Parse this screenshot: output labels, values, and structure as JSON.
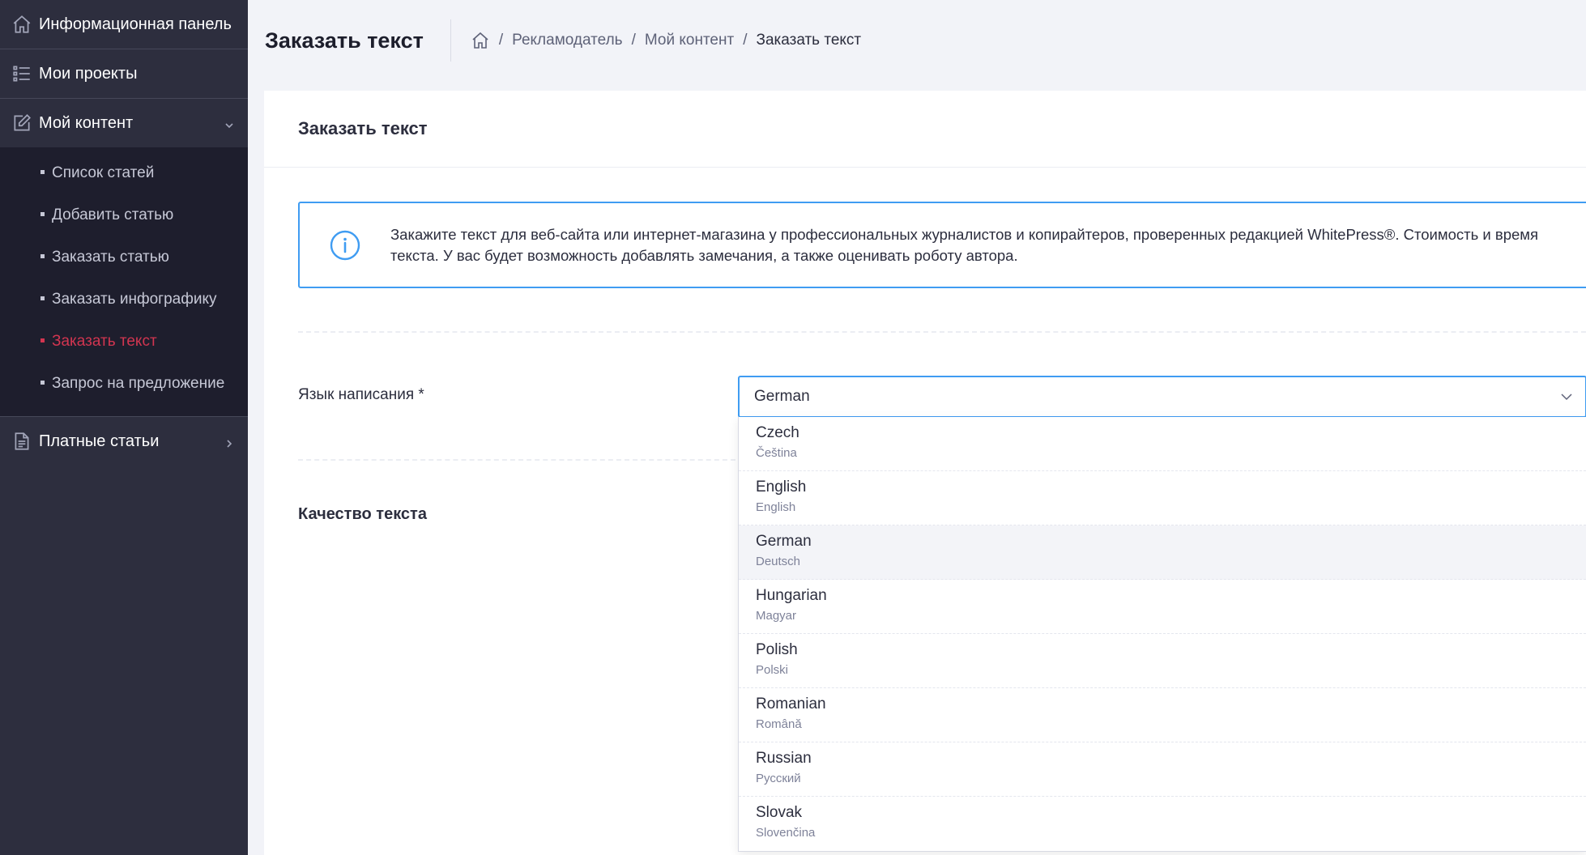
{
  "sidebar": {
    "items": [
      {
        "label": "Информационная панель",
        "icon": "home-icon"
      },
      {
        "label": "Мои проекты",
        "icon": "list-icon"
      },
      {
        "label": "Мой контент",
        "icon": "edit-icon",
        "expanded": true
      },
      {
        "label": "Платные статьи",
        "icon": "document-icon",
        "expanded": false
      }
    ],
    "sub_items": [
      {
        "label": "Список статей",
        "active": false
      },
      {
        "label": "Добавить статью",
        "active": false
      },
      {
        "label": "Заказать статью",
        "active": false
      },
      {
        "label": "Заказать инфографику",
        "active": false
      },
      {
        "label": "Заказать текст",
        "active": true
      },
      {
        "label": "Запрос на предложение",
        "active": false
      }
    ]
  },
  "header": {
    "title": "Заказать текст",
    "breadcrumb": [
      "Рекламодатель",
      "Мой контент",
      "Заказать текст"
    ]
  },
  "card": {
    "title": "Заказать текст",
    "alert_line1": "Закажите текст для веб-сайта или интернет-магазина у профессиональных журналистов и копирайтеров, проверенных редакцией WhitePress®. Стоимость и время",
    "alert_line2": "текста. У вас будет возможность добавлять замечания, а также оценивать роботу автора.",
    "language_label": "Язык написания *",
    "quality_label": "Качество текста"
  },
  "language_select": {
    "value": "German",
    "options": [
      {
        "name": "Czech",
        "native": "Čeština"
      },
      {
        "name": "English",
        "native": "English"
      },
      {
        "name": "German",
        "native": "Deutsch",
        "selected": true
      },
      {
        "name": "Hungarian",
        "native": "Magyar"
      },
      {
        "name": "Polish",
        "native": "Polski"
      },
      {
        "name": "Romanian",
        "native": "Română"
      },
      {
        "name": "Russian",
        "native": "Русский"
      },
      {
        "name": "Slovak",
        "native": "Slovenčina"
      }
    ]
  },
  "colors": {
    "sidebar_bg": "#2d2e3e",
    "submenu_bg": "#1e1e2d",
    "active_accent": "#d23550",
    "focus_blue": "#3f9cf2"
  }
}
